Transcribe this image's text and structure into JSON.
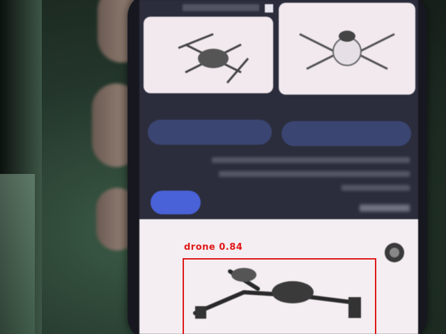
{
  "detection": {
    "label": "drone",
    "confidence": "0.84",
    "color": "#e01818"
  },
  "screen": {
    "background": "#2b2d3c",
    "accent": "#4a62d8"
  }
}
